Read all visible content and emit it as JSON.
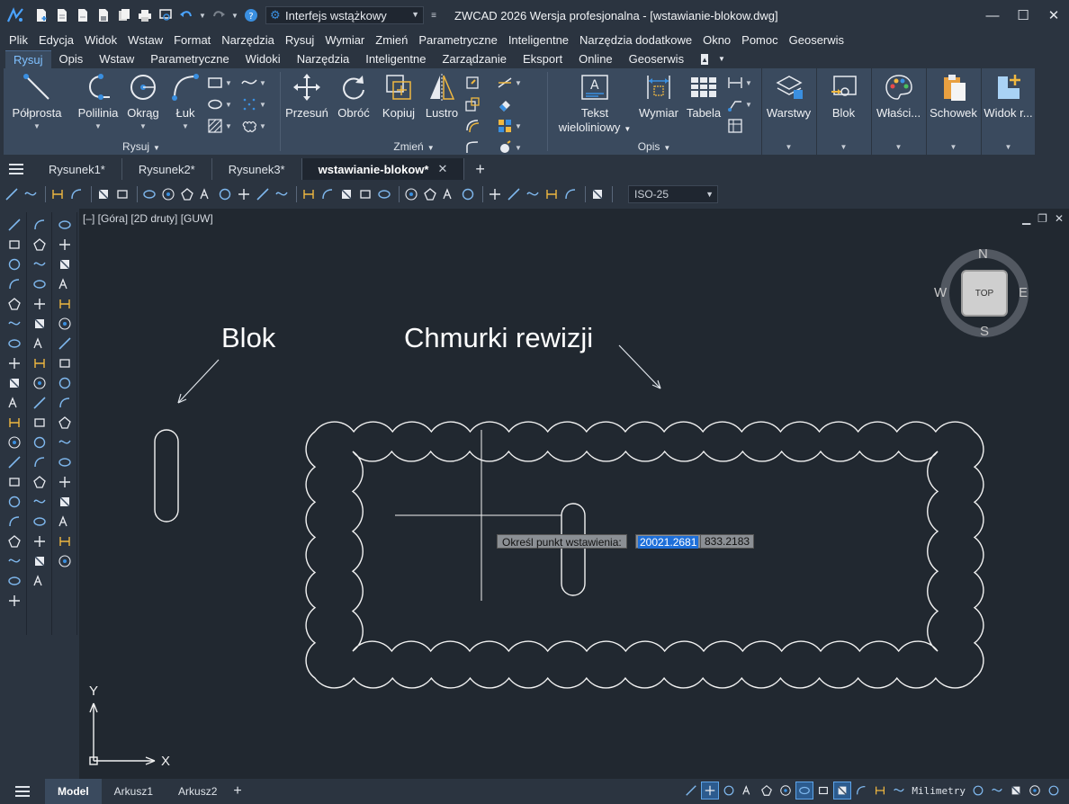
{
  "app": {
    "title": "ZWCAD 2026 Wersja profesjonalna - [wstawianie-blokow.dwg]",
    "workspace": "Interfejs wstążkowy"
  },
  "menu": [
    "Plik",
    "Edycja",
    "Widok",
    "Wstaw",
    "Format",
    "Narzędzia",
    "Rysuj",
    "Wymiar",
    "Zmień",
    "Parametryczne",
    "Inteligentne",
    "Narzędzia dodatkowe",
    "Okno",
    "Pomoc",
    "Geoserwis"
  ],
  "ribbon_tabs": [
    "Rysuj",
    "Opis",
    "Wstaw",
    "Parametryczne",
    "Widoki",
    "Narzędzia",
    "Inteligentne",
    "Zarządzanie",
    "Eksport",
    "Online",
    "Geoserwis"
  ],
  "ribbon_active_tab": "Rysuj",
  "ribbon": {
    "rysuj": {
      "title": "Rysuj",
      "buttons": [
        "Półprosta",
        "Polilinia",
        "Okrąg",
        "Łuk"
      ]
    },
    "zmien": {
      "title": "Zmień",
      "buttons": [
        "Przesuń",
        "Obróć",
        "Kopiuj",
        "Lustro"
      ]
    },
    "opis": {
      "title": "Opis",
      "tekst_line1": "Tekst",
      "tekst_line2": "wieloliniowy",
      "wymiar": "Wymiar",
      "tabela": "Tabela"
    },
    "panels": [
      "Warstwy",
      "Blok",
      "Właści...",
      "Schowek",
      "Widok r..."
    ]
  },
  "doc_tabs": [
    "Rysunek1*",
    "Rysunek2*",
    "Rysunek3*",
    "wstawianie-blokow*"
  ],
  "dim_style": "ISO-25",
  "viewport": {
    "label": "[–] [Góra] [2D druty] [GUW]",
    "compass": {
      "n": "N",
      "s": "S",
      "e": "E",
      "w": "W",
      "cube": "TOP"
    }
  },
  "annotations": {
    "blok": "Blok",
    "chmurki": "Chmurki rewizji"
  },
  "command": {
    "prompt": "Określ punkt wstawienia:",
    "x_value": "20021.2681",
    "y_value": "833.2183"
  },
  "ucs": {
    "x": "X",
    "y": "Y"
  },
  "layout_tabs": [
    "Model",
    "Arkusz1",
    "Arkusz2"
  ],
  "units": "Milimetry",
  "colors": {
    "accent": "#3a8fe0",
    "canvas": "#212830",
    "ribbon": "#3a4a5e"
  }
}
